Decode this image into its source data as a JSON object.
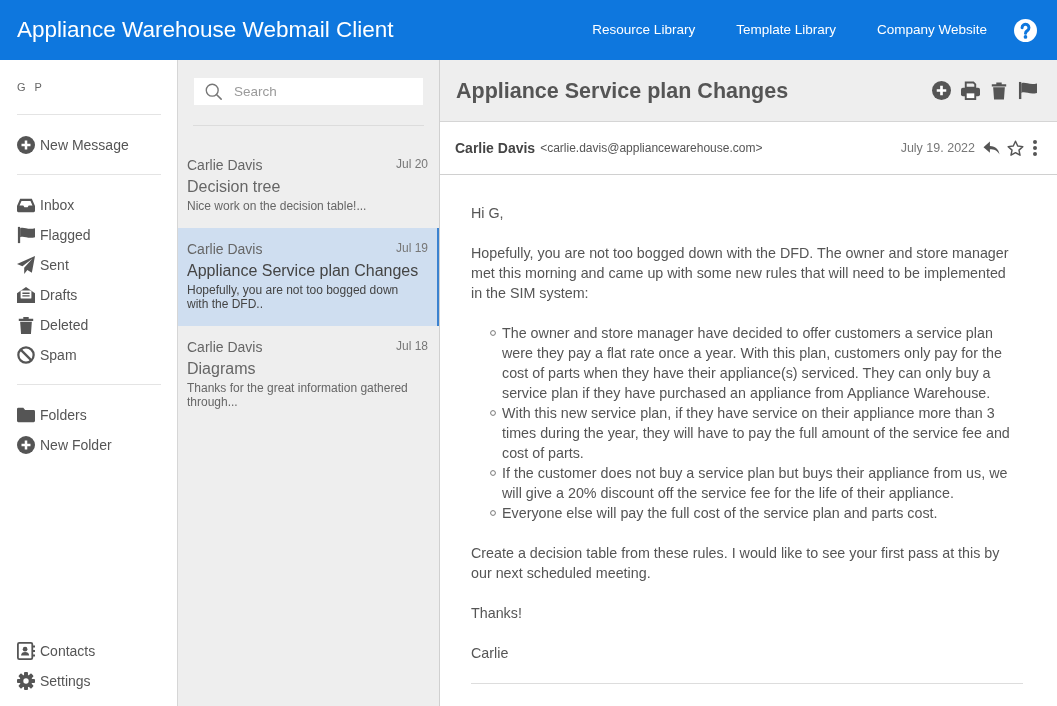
{
  "header": {
    "title": "Appliance Warehouse Webmail Client",
    "links": [
      "Resource Library",
      "Template Library",
      "Company Website"
    ]
  },
  "sidebar": {
    "user": "G P",
    "actions": [
      "New Message"
    ],
    "mailboxes": [
      "Inbox",
      "Flagged",
      "Sent",
      "Drafts",
      "Deleted",
      "Spam"
    ],
    "folders": [
      "Folders",
      "New Folder"
    ],
    "footer": [
      "Contacts",
      "Settings"
    ]
  },
  "message_list": {
    "search": {
      "placeholder": "Search"
    },
    "messages": [
      {
        "sender": "Carlie Davis",
        "date": "Jul 20",
        "subject": "Decision tree",
        "preview": "Nice work on the decision table!...",
        "selected": false
      },
      {
        "sender": "Carlie Davis",
        "date": "Jul 19",
        "subject": "Appliance Service plan Changes",
        "preview": "Hopefully, you are not too bogged down with the DFD..",
        "selected": true
      },
      {
        "sender": "Carlie Davis",
        "date": "Jul 18",
        "subject": "Diagrams",
        "preview": "Thanks for the great information gathered through...",
        "selected": false
      }
    ]
  },
  "reading_pane": {
    "subject": "Appliance Service plan Changes",
    "sender": {
      "name": "Carlie Davis",
      "email": "<carlie.davis@appliancewarehouse.com>"
    },
    "date": "July 19. 2022",
    "body": [
      {
        "kind": "paragraph",
        "text": "Hi G,"
      },
      {
        "kind": "paragraph",
        "text": "Hopefully, you are not too bogged down with the DFD. The owner and store manager met this morning and came up with some new rules that will need to be implemented in the SIM system:"
      },
      {
        "kind": "list",
        "items": [
          "The owner and store manager have decided to offer customers a service plan were they pay a flat rate once a year. With this plan, customers only pay for the cost of parts when they have their appliance(s) serviced. They can only buy a service plan if they have purchased an appliance from Appliance Warehouse.",
          "With this new service plan, if they have service on their appliance more than 3 times during the year, they will have to pay the full amount of the service fee and cost of parts.",
          "If the customer does not buy a service plan but buys their appliance from us, we will give a 20% discount off the service fee for the life of their appliance.",
          "Everyone else will pay the full cost of the service plan and parts cost."
        ]
      },
      {
        "kind": "paragraph",
        "text": "Create a decision table from these rules. I would like to see your first pass at this by our next scheduled meeting."
      },
      {
        "kind": "paragraph",
        "text": "Thanks!"
      },
      {
        "kind": "paragraph",
        "text": "Carlie"
      }
    ]
  }
}
